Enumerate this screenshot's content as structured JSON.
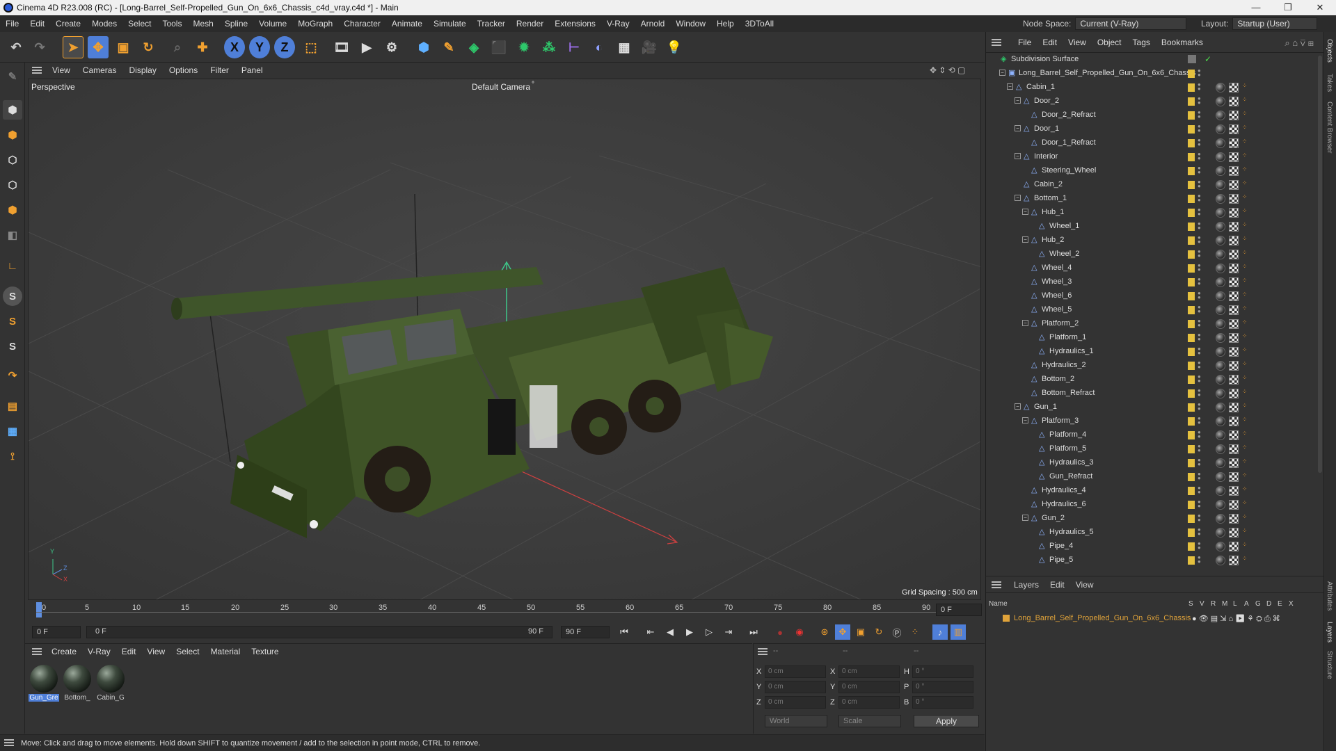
{
  "window": {
    "title": "Cinema 4D R23.008 (RC) - [Long-Barrel_Self-Propelled_Gun_On_6x6_Chassis_c4d_vray.c4d *] - Main",
    "minimize": "—",
    "maximize": "❐",
    "close": "✕"
  },
  "menubar": {
    "items": [
      "File",
      "Edit",
      "Create",
      "Modes",
      "Select",
      "Tools",
      "Mesh",
      "Spline",
      "Volume",
      "MoGraph",
      "Character",
      "Animate",
      "Simulate",
      "Tracker",
      "Render",
      "Extensions",
      "V-Ray",
      "Arnold",
      "Window",
      "Help",
      "3DToAll"
    ],
    "node_space_label": "Node Space:",
    "node_space_value": "Current (V-Ray)",
    "layout_label": "Layout:",
    "layout_value": "Startup (User)"
  },
  "toolbar": {
    "axis_x": "X",
    "axis_y": "Y",
    "axis_z": "Z"
  },
  "viewport": {
    "menu": [
      "View",
      "Cameras",
      "Display",
      "Options",
      "Filter",
      "Panel"
    ],
    "label": "Perspective",
    "camera": "Default Camera",
    "camera_mark": "°",
    "grid_spacing": "Grid Spacing : 500 cm",
    "axis_y": "Y",
    "axis_z": "Z",
    "axis_x": "X"
  },
  "timeline": {
    "ticks": [
      "0",
      "5",
      "10",
      "15",
      "20",
      "25",
      "30",
      "35",
      "40",
      "45",
      "50",
      "55",
      "60",
      "65",
      "70",
      "75",
      "80",
      "85",
      "90"
    ],
    "end_field": "0 F"
  },
  "transport": {
    "current": "0 F",
    "range_start": "0 F",
    "range_end": "90 F",
    "max": "90 F"
  },
  "materials": {
    "menu": [
      "Create",
      "V-Ray",
      "Edit",
      "View",
      "Select",
      "Material",
      "Texture"
    ],
    "items": [
      "Gun_Gre",
      "Bottom_",
      "Cabin_G"
    ]
  },
  "attributes": {
    "header": [
      "--",
      "--",
      "--"
    ],
    "rows": [
      {
        "a": "X",
        "av": "0 cm",
        "b": "X",
        "bv": "0 cm",
        "c": "H",
        "cv": "0 °"
      },
      {
        "a": "Y",
        "av": "0 cm",
        "b": "Y",
        "bv": "0 cm",
        "c": "P",
        "cv": "0 °"
      },
      {
        "a": "Z",
        "av": "0 cm",
        "b": "Z",
        "bv": "0 cm",
        "c": "B",
        "cv": "0 °"
      }
    ],
    "coord_system": "World",
    "mode": "Scale",
    "apply": "Apply"
  },
  "status": "Move: Click and drag to move elements. Hold down SHIFT to quantize movement / add to the selection in point mode, CTRL to remove.",
  "objects": {
    "menu": [
      "File",
      "Edit",
      "View",
      "Object",
      "Tags",
      "Bookmarks"
    ],
    "rows": [
      {
        "name": "Subdivision Surface",
        "indent": 0,
        "exp": "",
        "icon": "◈"
      },
      {
        "name": "Long_Barrel_Self_Propelled_Gun_On_6x6_Chassis",
        "indent": 1,
        "exp": "−",
        "icon": "▣"
      },
      {
        "name": "Cabin_1",
        "indent": 2,
        "exp": "−",
        "icon": "△"
      },
      {
        "name": "Door_2",
        "indent": 3,
        "exp": "−",
        "icon": "△"
      },
      {
        "name": "Door_2_Refract",
        "indent": 4,
        "exp": "",
        "icon": "△"
      },
      {
        "name": "Door_1",
        "indent": 3,
        "exp": "−",
        "icon": "△"
      },
      {
        "name": "Door_1_Refract",
        "indent": 4,
        "exp": "",
        "icon": "△"
      },
      {
        "name": "Interior",
        "indent": 3,
        "exp": "−",
        "icon": "△"
      },
      {
        "name": "Steering_Wheel",
        "indent": 4,
        "exp": "",
        "icon": "△"
      },
      {
        "name": "Cabin_2",
        "indent": 3,
        "exp": "",
        "icon": "△"
      },
      {
        "name": "Bottom_1",
        "indent": 3,
        "exp": "−",
        "icon": "△"
      },
      {
        "name": "Hub_1",
        "indent": 4,
        "exp": "−",
        "icon": "△"
      },
      {
        "name": "Wheel_1",
        "indent": 5,
        "exp": "",
        "icon": "△"
      },
      {
        "name": "Hub_2",
        "indent": 4,
        "exp": "−",
        "icon": "△"
      },
      {
        "name": "Wheel_2",
        "indent": 5,
        "exp": "",
        "icon": "△"
      },
      {
        "name": "Wheel_4",
        "indent": 4,
        "exp": "",
        "icon": "△"
      },
      {
        "name": "Wheel_3",
        "indent": 4,
        "exp": "",
        "icon": "△"
      },
      {
        "name": "Wheel_6",
        "indent": 4,
        "exp": "",
        "icon": "△"
      },
      {
        "name": "Wheel_5",
        "indent": 4,
        "exp": "",
        "icon": "△"
      },
      {
        "name": "Platform_2",
        "indent": 4,
        "exp": "−",
        "icon": "△"
      },
      {
        "name": "Platform_1",
        "indent": 5,
        "exp": "",
        "icon": "△"
      },
      {
        "name": "Hydraulics_1",
        "indent": 5,
        "exp": "",
        "icon": "△"
      },
      {
        "name": "Hydraulics_2",
        "indent": 4,
        "exp": "",
        "icon": "△"
      },
      {
        "name": "Bottom_2",
        "indent": 4,
        "exp": "",
        "icon": "△"
      },
      {
        "name": "Bottom_Refract",
        "indent": 4,
        "exp": "",
        "icon": "△"
      },
      {
        "name": "Gun_1",
        "indent": 3,
        "exp": "−",
        "icon": "△"
      },
      {
        "name": "Platform_3",
        "indent": 4,
        "exp": "−",
        "icon": "△"
      },
      {
        "name": "Platform_4",
        "indent": 5,
        "exp": "",
        "icon": "△"
      },
      {
        "name": "Platform_5",
        "indent": 5,
        "exp": "",
        "icon": "△"
      },
      {
        "name": "Hydraulics_3",
        "indent": 5,
        "exp": "",
        "icon": "△"
      },
      {
        "name": "Gun_Refract",
        "indent": 5,
        "exp": "",
        "icon": "△"
      },
      {
        "name": "Hydraulics_4",
        "indent": 4,
        "exp": "",
        "icon": "△"
      },
      {
        "name": "Hydraulics_6",
        "indent": 4,
        "exp": "",
        "icon": "△"
      },
      {
        "name": "Gun_2",
        "indent": 4,
        "exp": "−",
        "icon": "△"
      },
      {
        "name": "Hydraulics_5",
        "indent": 5,
        "exp": "",
        "icon": "△"
      },
      {
        "name": "Pipe_4",
        "indent": 5,
        "exp": "",
        "icon": "△"
      },
      {
        "name": "Pipe_5",
        "indent": 5,
        "exp": "",
        "icon": "△"
      }
    ]
  },
  "layers": {
    "menu": [
      "Layers",
      "Edit",
      "View"
    ],
    "col_name": "Name",
    "cols": [
      "S",
      "V",
      "R",
      "M",
      "L",
      "A",
      "G",
      "D",
      "E",
      "X"
    ],
    "item": "Long_Barrel_Self_Propelled_Gun_On_6x6_Chassis",
    "item_color": "#e0a33a"
  },
  "side_tabs": [
    "Objects",
    "Takes",
    "Content Browser",
    "Attributes",
    "Layers",
    "Structure"
  ],
  "colors": {
    "accent": "#f0a030",
    "select_blue": "#4f7fd8",
    "layer_orange": "#e0a33a"
  }
}
